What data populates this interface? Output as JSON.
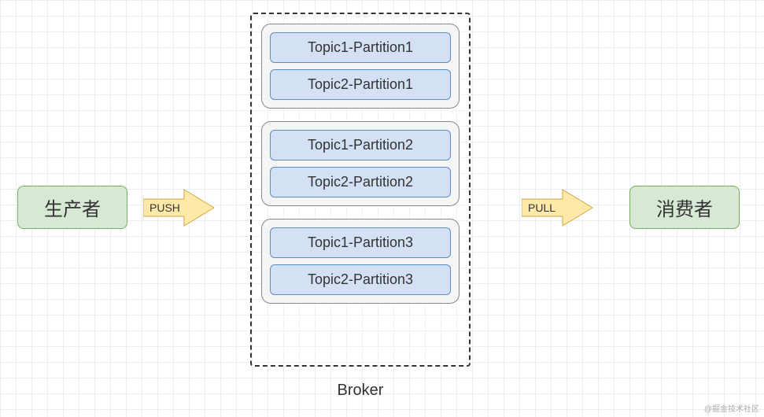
{
  "producer": {
    "label": "生产者"
  },
  "consumer": {
    "label": "消费者"
  },
  "arrow_push": {
    "label": "PUSH"
  },
  "arrow_pull": {
    "label": "PULL"
  },
  "broker": {
    "label": "Broker",
    "groups": [
      {
        "partitions": [
          "Topic1-Partition1",
          "Topic2-Partition1"
        ]
      },
      {
        "partitions": [
          "Topic1-Partition2",
          "Topic2-Partition2"
        ]
      },
      {
        "partitions": [
          "Topic1-Partition3",
          "Topic2-Partition3"
        ]
      }
    ]
  },
  "watermark": "@掘金技术社区",
  "colors": {
    "node_green_fill": "#d7e8d4",
    "node_green_border": "#7aaa5e",
    "arrow_fill": "#ffe9a8",
    "arrow_stroke": "#d4a93e",
    "partition_fill": "#d4e1f5",
    "partition_border": "#5a8fbf",
    "group_fill": "#f5f5f5",
    "group_border": "#888888"
  }
}
